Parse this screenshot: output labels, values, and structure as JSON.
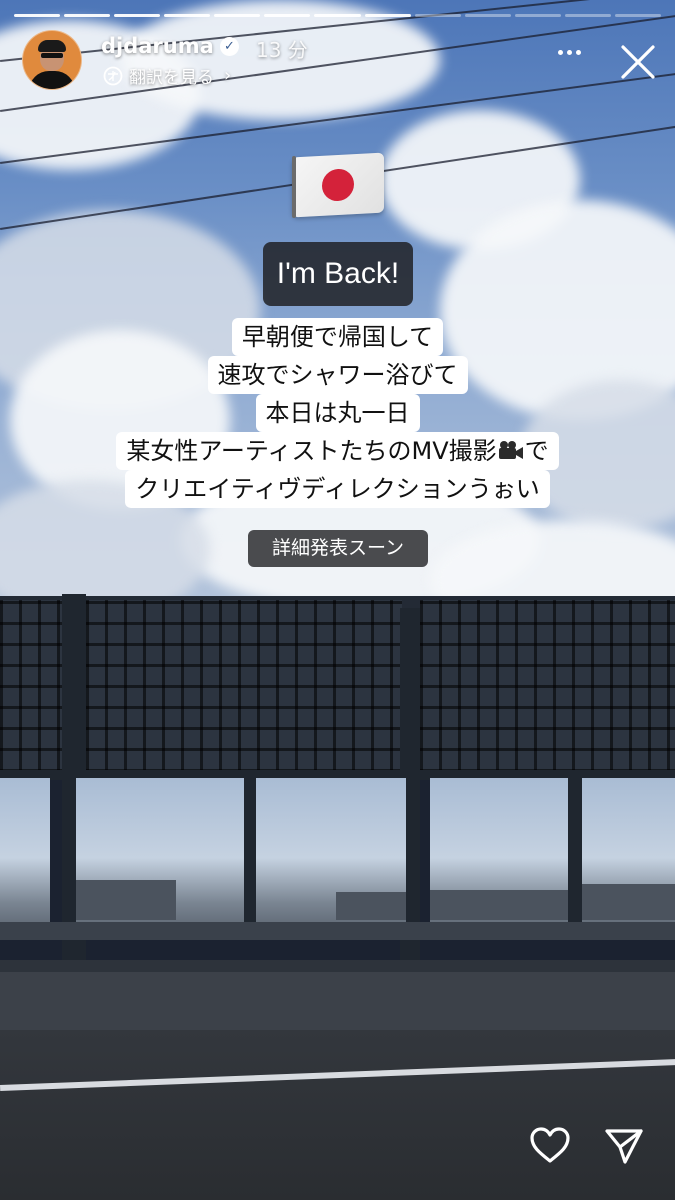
{
  "story": {
    "segments_total": 13,
    "segments_viewed": 8
  },
  "header": {
    "username": "djdaruma",
    "verified": true,
    "posted_time": "13 分",
    "translate_label": "翻訳を見る",
    "icons": {
      "verified": "verified-badge-icon",
      "translate": "translate-icon",
      "translate_arrow": "chevron-right-icon",
      "more": "more-options-icon",
      "close": "close-icon"
    }
  },
  "stickers": {
    "flag": "japan-flag-sticker",
    "headline": "I'm Back!",
    "caption_lines": [
      "早朝便で帰国して",
      "速攻でシャワー浴びて",
      "本日は丸一日",
      "某女性アーティストたちのMV撮影",
      "クリエイティヴディレクションうぉい"
    ],
    "caption_line4_suffix": "で",
    "caption_emoji": "movie-camera-icon",
    "detail_note": "詳細発表スーン"
  },
  "actions": {
    "like_icon": "heart-icon",
    "share_icon": "send-icon"
  },
  "colors": {
    "caption_background": "#ffffff",
    "caption_text": "#111111",
    "headline_background": "#1c1c1e",
    "flag_sun": "#d4223a"
  }
}
